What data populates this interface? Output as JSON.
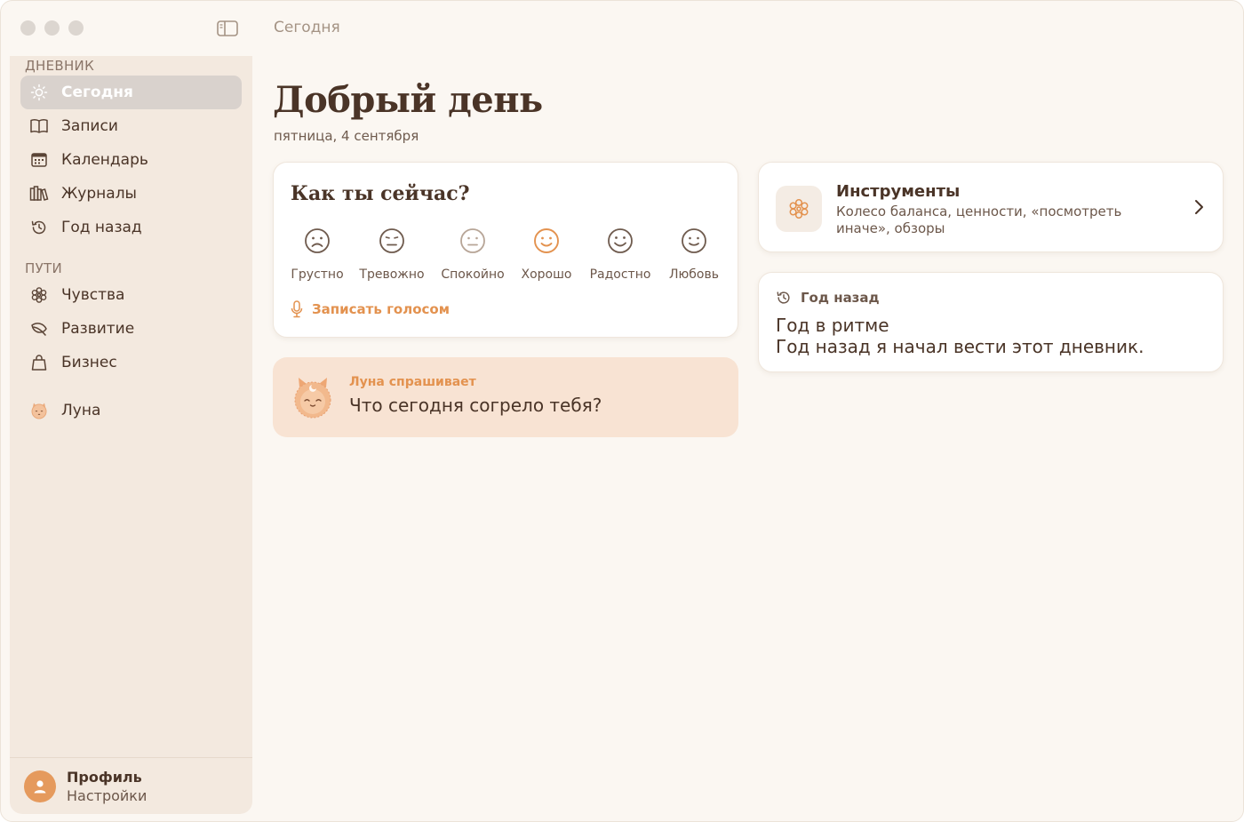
{
  "window": {
    "title": "Сегодня"
  },
  "sidebar": {
    "section_diary": "ДНЕВНИК",
    "section_paths": "ПУТИ",
    "items": [
      {
        "label": "Сегодня",
        "icon": "sun-icon",
        "active": true
      },
      {
        "label": "Записи",
        "icon": "book-icon"
      },
      {
        "label": "Календарь",
        "icon": "calendar-icon"
      },
      {
        "label": "Журналы",
        "icon": "books-icon"
      },
      {
        "label": "Год назад",
        "icon": "history-icon"
      }
    ],
    "paths": [
      {
        "label": "Чувства",
        "icon": "flower-icon"
      },
      {
        "label": "Развитие",
        "icon": "leaf-icon"
      },
      {
        "label": "Бизнес",
        "icon": "bag-icon"
      }
    ],
    "luna": {
      "label": "Луна",
      "icon": "luna-icon"
    },
    "profile": {
      "name": "Профиль",
      "settings": "Настройки"
    }
  },
  "main": {
    "greeting": "Добрый день",
    "date": "пятница, 4 сентября",
    "mood": {
      "title": "Как ты сейчас?",
      "options": [
        "Грустно",
        "Тревожно",
        "Спокойно",
        "Хорошо",
        "Радостно",
        "Любовь"
      ],
      "selected": "Хорошо",
      "voice_label": "Записать голосом"
    },
    "luna_prompt": {
      "who": "Луна спрашивает",
      "question": "Что сегодня согрело тебя?"
    },
    "tools": {
      "title": "Инструменты",
      "subtitle": "Колесо баланса, ценности, «посмотреть иначе», обзоры"
    },
    "year_ago": {
      "label": "Год назад",
      "title": "Год в ритме",
      "text": "Год назад я начал вести этот дневник."
    }
  },
  "colors": {
    "accent": "#e3924f",
    "background": "#fbf7f2",
    "sidebar": "#f3e9df",
    "text": "#4a3427",
    "luna_card": "#f8e3d3"
  }
}
